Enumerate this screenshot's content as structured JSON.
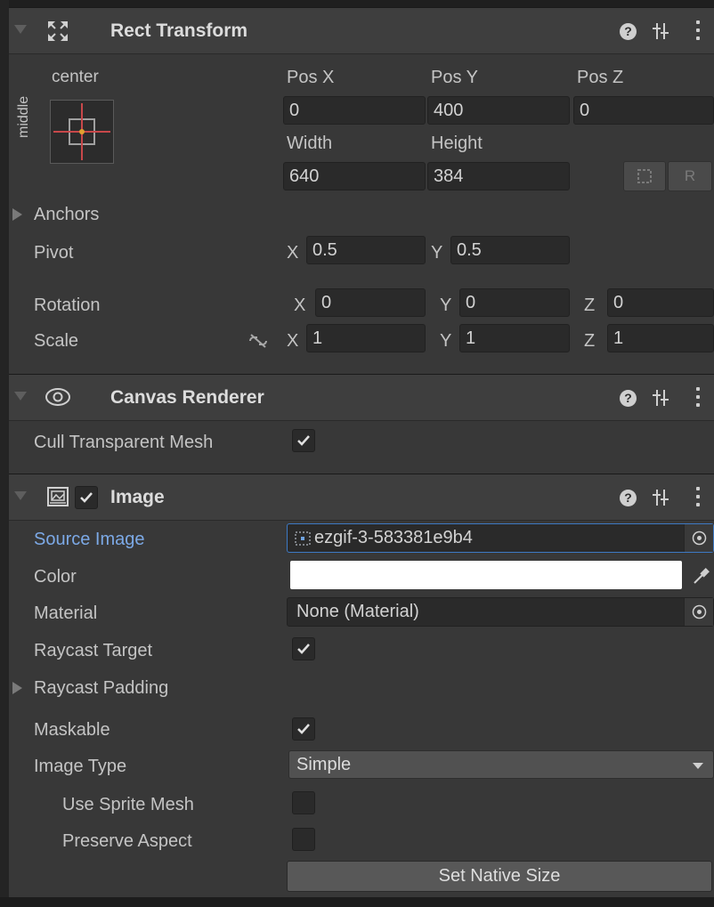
{
  "rect_transform": {
    "title": "Rect Transform",
    "anchor_preset": {
      "h": "center",
      "v": "middle"
    },
    "pos_x": {
      "label": "Pos X",
      "value": "0"
    },
    "pos_y": {
      "label": "Pos Y",
      "value": "400"
    },
    "pos_z": {
      "label": "Pos Z",
      "value": "0"
    },
    "width": {
      "label": "Width",
      "value": "640"
    },
    "height": {
      "label": "Height",
      "value": "384"
    },
    "raw_button": "R",
    "anchors_label": "Anchors",
    "pivot": {
      "label": "Pivot",
      "x_axis": "X",
      "x": "0.5",
      "y_axis": "Y",
      "y": "0.5"
    },
    "rotation": {
      "label": "Rotation",
      "x_axis": "X",
      "x": "0",
      "y_axis": "Y",
      "y": "0",
      "z_axis": "Z",
      "z": "0"
    },
    "scale": {
      "label": "Scale",
      "x_axis": "X",
      "x": "1",
      "y_axis": "Y",
      "y": "1",
      "z_axis": "Z",
      "z": "1"
    }
  },
  "canvas_renderer": {
    "title": "Canvas Renderer",
    "cull_label": "Cull Transparent Mesh",
    "cull_checked": true
  },
  "image": {
    "title": "Image",
    "enabled": true,
    "source_image": {
      "label": "Source Image",
      "value": "ezgif-3-583381e9b4"
    },
    "color": {
      "label": "Color",
      "value": "#ffffff"
    },
    "material": {
      "label": "Material",
      "value": "None (Material)"
    },
    "raycast_target": {
      "label": "Raycast Target",
      "checked": true
    },
    "raycast_padding_label": "Raycast Padding",
    "maskable": {
      "label": "Maskable",
      "checked": true
    },
    "image_type": {
      "label": "Image Type",
      "value": "Simple"
    },
    "use_sprite_mesh": {
      "label": "Use Sprite Mesh",
      "checked": false
    },
    "preserve_aspect": {
      "label": "Preserve Aspect",
      "checked": false
    },
    "set_native_size": "Set Native Size"
  },
  "colors": {
    "background": "#383838",
    "header": "#3e3e3e",
    "field": "#2a2a2a",
    "accent_blue": "#7ca9e6",
    "focus_border": "#3d79c4"
  }
}
